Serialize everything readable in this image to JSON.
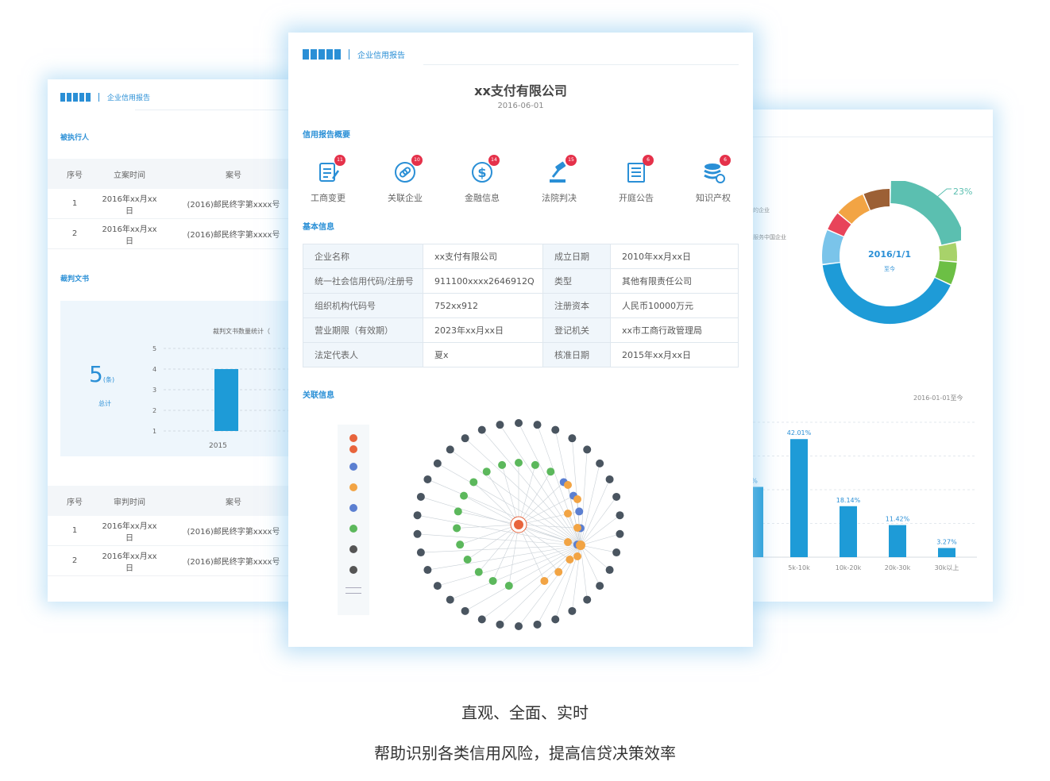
{
  "report_label": "企业信用报告",
  "left_card": {
    "section1_title": "被执行人",
    "table1": {
      "headers": [
        "序号",
        "立案时间",
        "案号"
      ],
      "rows": [
        [
          "1",
          "2016年xx月xx日",
          "(2016)邮民终字第xxxx号"
        ],
        [
          "2",
          "2016年xx月xx日",
          "(2016)邮民终字第xxxx号"
        ]
      ]
    },
    "section2_title": "裁判文书",
    "stat": {
      "value": "5",
      "unit": "(条)",
      "label": "总计"
    },
    "mini_chart": {
      "title": "裁判文书数量统计（",
      "yticks": [
        "5",
        "4",
        "3",
        "2",
        "1"
      ],
      "category": "2015"
    },
    "table2": {
      "headers": [
        "序号",
        "审判时间",
        "案号"
      ],
      "rows": [
        [
          "1",
          "2016年xx月xx日",
          "(2016)邮民终字第xxxx号"
        ],
        [
          "2",
          "2016年xx月xx日",
          "(2016)邮民终字第xxxx号"
        ]
      ]
    }
  },
  "center_card": {
    "company_name": "xx支付有限公司",
    "report_date": "2016-06-01",
    "summary_title": "信用报告概要",
    "summary_items": [
      {
        "label": "工商变更",
        "badge": "11",
        "icon": "edit-document-icon",
        "color": "#2a8fd6"
      },
      {
        "label": "关联企业",
        "badge": "10",
        "icon": "link-icon",
        "color": "#2a8fd6"
      },
      {
        "label": "金融信息",
        "badge": "14",
        "icon": "dollar-coin-icon",
        "color": "#2a8fd6"
      },
      {
        "label": "法院判决",
        "badge": "15",
        "icon": "gavel-icon",
        "color": "#2a8fd6"
      },
      {
        "label": "开庭公告",
        "badge": "6",
        "icon": "notice-icon",
        "color": "#2a8fd6"
      },
      {
        "label": "知识产权",
        "badge": "6",
        "icon": "stack-icon",
        "color": "#2a8fd6"
      }
    ],
    "basic_title": "基本信息",
    "basic_info": [
      [
        "企业名称",
        "xx支付有限公司",
        "成立日期",
        "2010年xx月xx日"
      ],
      [
        "统一社会信用代码/注册号",
        "911100xxxx2646912Q",
        "类型",
        "其他有限责任公司"
      ],
      [
        "组织机构代码号",
        "752xx912",
        "注册资本",
        "人民币10000万元"
      ],
      [
        "营业期限（有效期）",
        "2023年xx月xx日",
        "登记机关",
        "xx市工商行政管理局"
      ],
      [
        "法定代表人",
        "夏x",
        "核准日期",
        "2015年xx月xx日"
      ]
    ],
    "related_title": "关联信息"
  },
  "right_card": {
    "donut": {
      "center_date": "2016/1/1",
      "center_sub": "至今",
      "percent_label": "23%",
      "segments": [
        {
          "value": 23,
          "color": "#5bbfb0"
        },
        {
          "value": 5,
          "color": "#a8d26a"
        },
        {
          "value": 6,
          "color": "#6cbf45"
        },
        {
          "value": 44,
          "color": "#1e9bd7"
        },
        {
          "value": 9,
          "color": "#7ac4ea"
        },
        {
          "value": 5,
          "color": "#e8445a"
        },
        {
          "value": 8,
          "color": "#f2a444"
        },
        {
          "value": 7,
          "color": "#9c6035"
        }
      ]
    },
    "legend_fragments": [
      "的企业",
      "服务中国企业"
    ],
    "chart_data": {
      "type": "bar",
      "title": "2016-01-01至今",
      "categories": [
        "",
        "5k-10k",
        "10k-20k",
        "20k-30k",
        "30k以上"
      ],
      "values": [
        25,
        42.01,
        18.14,
        11.42,
        3.27
      ],
      "data_labels": [
        "%",
        "42.01%",
        "18.14%",
        "11.42%",
        "3.27%"
      ],
      "ylim": [
        0,
        48
      ],
      "color": "#1e9bd7"
    }
  },
  "caption": {
    "line1": "直观、全面、实时",
    "line2": "帮助识别各类信用风险，提高信贷决策效率"
  }
}
